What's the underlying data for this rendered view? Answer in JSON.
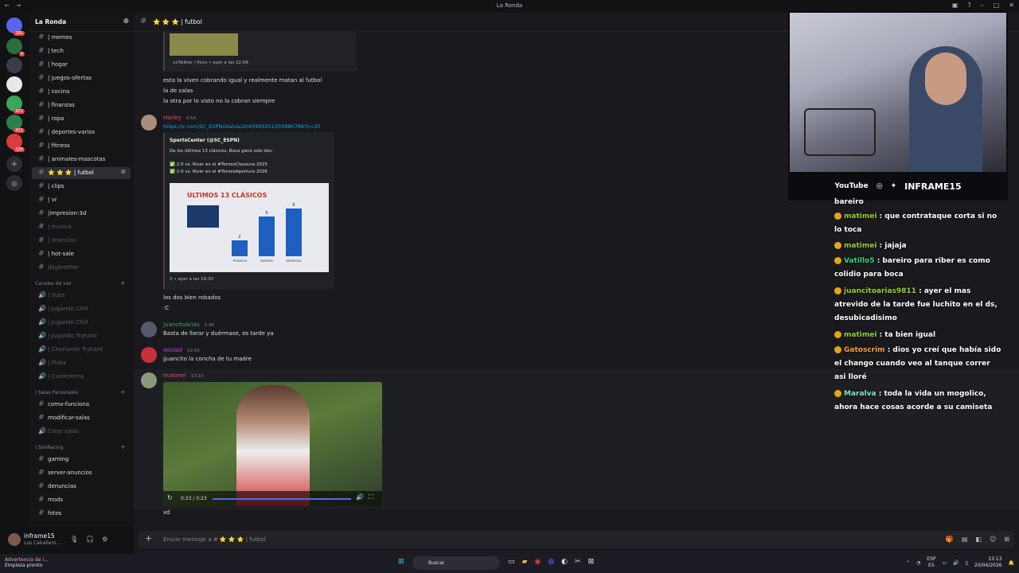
{
  "window": {
    "title": "La Ronda"
  },
  "server": {
    "name": "La Ronda"
  },
  "rail": [
    {
      "badge": "181",
      "color": "#5865f2"
    },
    {
      "badge": "9",
      "color": "#2b6e3a",
      "label": "LA RONDA"
    },
    {
      "badge": "",
      "color": "#3b3d48"
    },
    {
      "badge": "",
      "color": "#e8e8e8"
    },
    {
      "badge": "407",
      "color": "#3ba55c"
    },
    {
      "badge": "421",
      "color": "#2c7d4f"
    },
    {
      "badge": "128",
      "color": "#d83c3e"
    }
  ],
  "channels": [
    {
      "label": "| memes"
    },
    {
      "label": "| tech"
    },
    {
      "label": "| hogar"
    },
    {
      "label": "| juegos-ofertas"
    },
    {
      "label": "| cocina"
    },
    {
      "label": "| finanzas"
    },
    {
      "label": "| ropa"
    },
    {
      "label": "| deportes-varios"
    },
    {
      "label": "| fitness"
    },
    {
      "label": "| animales-mascotas"
    },
    {
      "label": "⭐ ⭐ ⭐ | futbol"
    },
    {
      "label": "| clips"
    },
    {
      "label": "| vr"
    },
    {
      "label": "|impresion-3d"
    },
    {
      "label": "| musica"
    },
    {
      "label": "| anuncios"
    },
    {
      "label": "| hot-sale"
    },
    {
      "label": "|bigbrother"
    }
  ],
  "voice_category": "Canales de voz",
  "voice_channels": [
    {
      "label": "| Subs"
    },
    {
      "label": "| Jugando Chill"
    },
    {
      "label": "| Jugando Chill"
    },
    {
      "label": "| Jugando Tryhard"
    },
    {
      "label": "| Charlando Tryhard"
    },
    {
      "label": "| Plebs"
    },
    {
      "label": "| Cuarentena"
    }
  ],
  "salas_category": "| Salas Personales",
  "salas": [
    {
      "label": "como-funciona"
    },
    {
      "label": "modificar-salas"
    },
    {
      "label": "Crear salas"
    }
  ],
  "simracing_category": "| SimRacing",
  "simracing": [
    {
      "label": "gaming"
    },
    {
      "label": "server-anuncios"
    },
    {
      "label": "denuncias"
    },
    {
      "label": "mods"
    },
    {
      "label": "fotos"
    }
  ],
  "user": {
    "name": "inframe15",
    "status": "Los Caballero..."
  },
  "channel_header": {
    "title": "⭐ ⭐ ⭐ | futbol"
  },
  "messages": {
    "embed_footer": "vxTwitter / fixvx • ayer a las 22:08",
    "lines_a": [
      "esta la viven cobrando igual y realmente matan al futbol",
      "la de salas",
      "la otra por lo visto no la cobran siempre"
    ],
    "harley": {
      "name": "Harley",
      "time": "0:54",
      "link": "https://x.com/SC_ESPN/status/2045993351350980786?s=20"
    },
    "tweet": {
      "author": "SportsCenter (@SC_ESPN)",
      "text": "De los últimos 13 clásicos, Boca ganó solo dos:",
      "items": [
        "✅ 2-0 vs. River en el #TorneoClausura 2025",
        "✅ 1-0 vs. River en el #TorneoApertura 2026"
      ],
      "footer": "X • ayer a las 19:30"
    },
    "lines_b": [
      "los dos bien robados",
      ":C"
    ],
    "juancito": {
      "name": "JuancitoArias",
      "time": "1:46",
      "text": "Basta de llorar y duérmase, es tarde ya"
    },
    "deidad": {
      "name": "deidad",
      "time": "13:03",
      "text": "jjuancito la concha de tu madre"
    },
    "matimei": {
      "name": "matimei",
      "time": "13:10",
      "video_time": "0:23 / 0:23"
    },
    "xd": "xd"
  },
  "chart_data": {
    "type": "bar",
    "title": "ÚLTIMOS 13 CLÁSICOS",
    "categories": [
      "TRIUNFOS",
      "EMPATES",
      "DERROTAS"
    ],
    "values": [
      2,
      5,
      6
    ]
  },
  "composer": {
    "placeholder": "Enviar mensaje a # ⭐ ⭐ ⭐ | futbol"
  },
  "webcam": {
    "social_youtube": "YouTube",
    "handle": "INFRAME15"
  },
  "chat": [
    {
      "name": "",
      "text": "bareiro",
      "color": "#ffffff"
    },
    {
      "name": "matimei",
      "text": ": que contrataque corta si no lo toca",
      "color": "#9acd32"
    },
    {
      "name": "matimei",
      "text": ": jajaja",
      "color": "#9acd32"
    },
    {
      "name": "Vatillo5",
      "text": ": bareiro para riber es como colidio para boca",
      "color": "#3ad17a"
    },
    {
      "name": "juancitoarias9811",
      "text": ": ayer el mas atrevido de la tarde fue luchito en el ds, desubicadisimo",
      "color": "#9acd32"
    },
    {
      "name": "matimei",
      "text": ": ta bien igual",
      "color": "#9acd32"
    },
    {
      "name": "Gatoscrim",
      "text": ": dios yo creí que había sido el chango cuando veo al tanque correr asi lloré",
      "color": "#ff9f3a"
    },
    {
      "name": "Maralva",
      "text": ": toda la vida un mogolico, ahora hace cosas acorde a su camiseta",
      "color": "#7fe8d4"
    }
  ],
  "taskbar": {
    "warning": "Advertencia de l...",
    "warning_sub": "Empieza pronto",
    "search": "Buscar",
    "lang": "ESP",
    "lang_sub": "ES",
    "time": "13:13",
    "date": "20/04/2026"
  }
}
